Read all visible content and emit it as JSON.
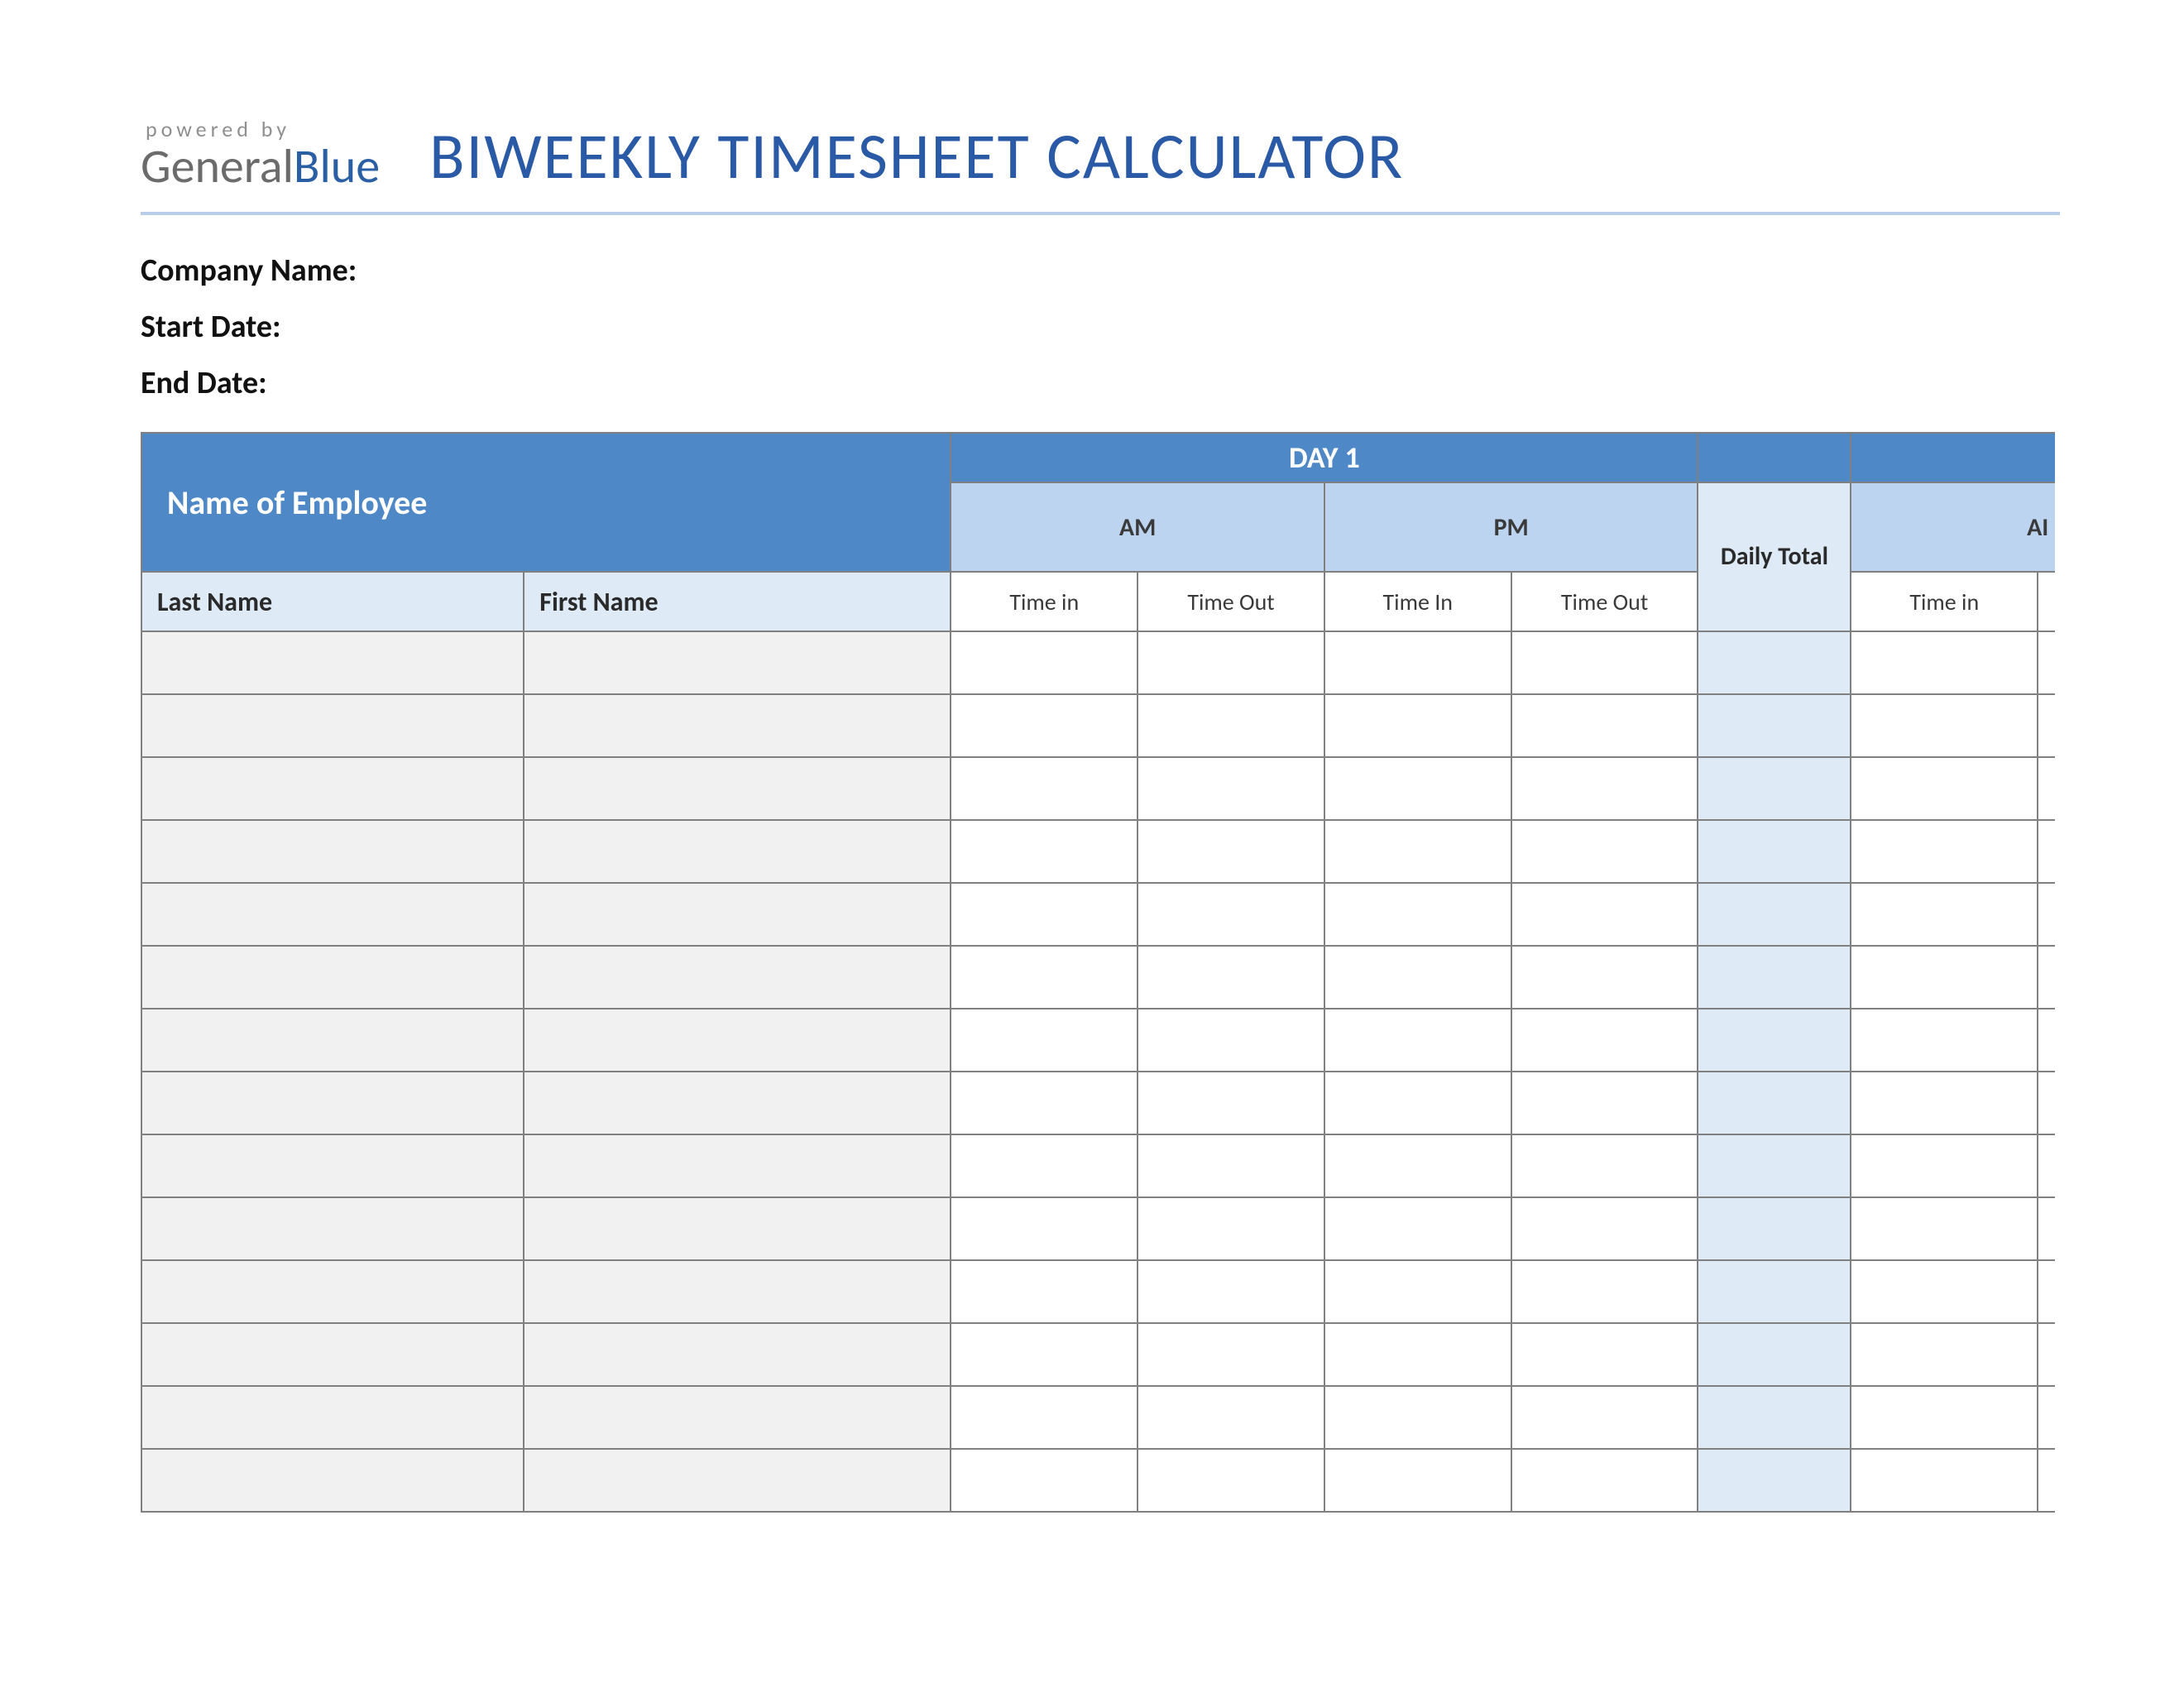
{
  "logo": {
    "powered_by": "powered by",
    "brand_general": "General",
    "brand_blue": "Blue"
  },
  "title": "BIWEEKLY TIMESHEET CALCULATOR",
  "meta": {
    "company_label": "Company Name:",
    "company_value": "",
    "start_label": "Start Date:",
    "start_value": "",
    "end_label": "End Date:",
    "end_value": ""
  },
  "table": {
    "employee_header": "Name of Employee",
    "day1_header": "DAY 1",
    "day2_header": "",
    "am_label": "AM",
    "pm_label": "PM",
    "daily_total_label": "Daily Total",
    "am2_label_partial": "AI",
    "last_name_label": "Last Name",
    "first_name_label": "First Name",
    "time_in_label": "Time in",
    "time_out_label": "Time Out",
    "time_in_label2": "Time In",
    "row_count": 14
  },
  "colors": {
    "brand_blue": "#2a5aa5",
    "header_blue": "#4f88c6",
    "light_blue": "#bcd4ef",
    "pale_blue": "#deeaf6",
    "rule_blue": "#b9cde9",
    "grid_gray": "#808080",
    "name_fill": "#f1f1f1"
  }
}
